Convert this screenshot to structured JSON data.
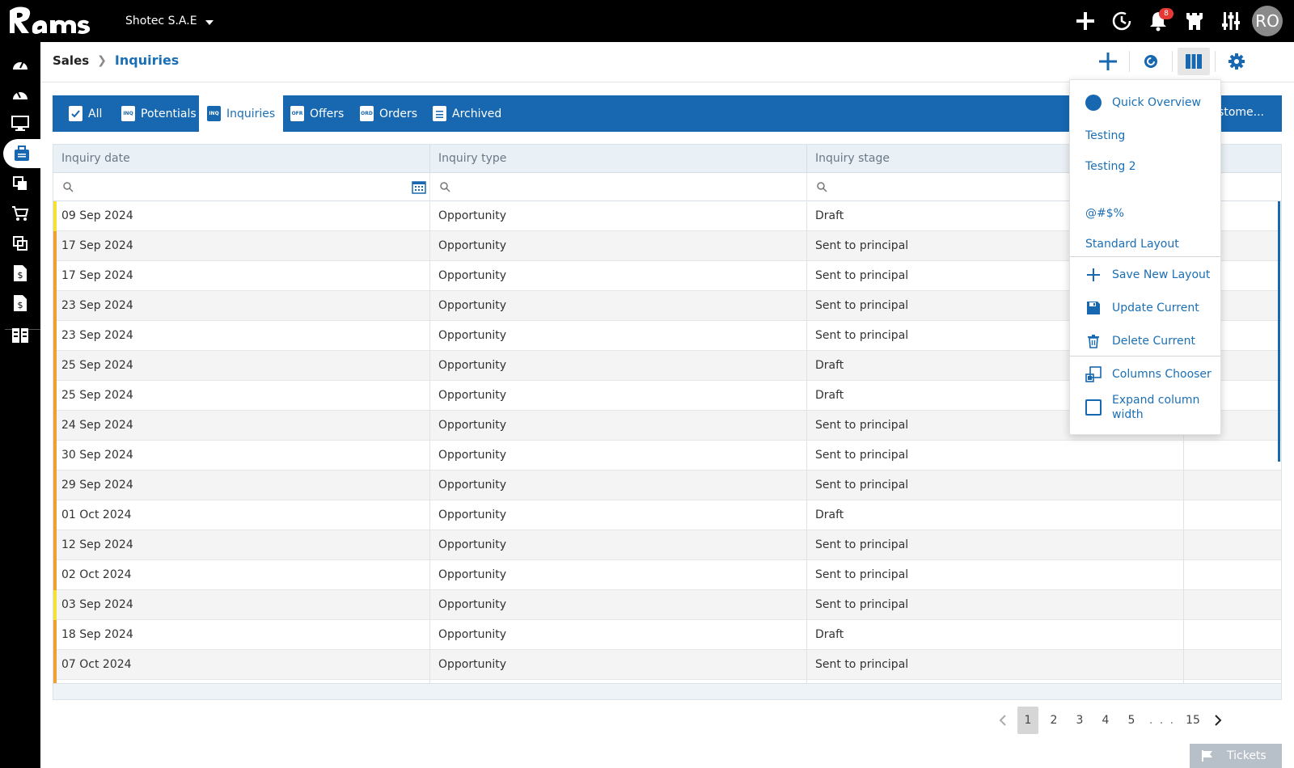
{
  "app": {
    "logo_text": "Rams"
  },
  "topbar": {
    "company": "Shotec S.A.E",
    "notification_count": "8",
    "avatar_initials": "RO"
  },
  "breadcrumb": {
    "root": "Sales",
    "current": "Inquiries"
  },
  "tabs": [
    {
      "label": "All",
      "icon": "checkbox-icon"
    },
    {
      "label": "Potentials",
      "icon": "INQ"
    },
    {
      "label": "Inquiries",
      "icon": "INQ"
    },
    {
      "label": "Offers",
      "icon": "OFR"
    },
    {
      "label": "Orders",
      "icon": "ORD"
    },
    {
      "label": "Archived",
      "icon": "doc-icon"
    }
  ],
  "tabs_right_label": "Custome...",
  "grid": {
    "columns": [
      "Inquiry date",
      "Inquiry type",
      "Inquiry stage",
      ""
    ],
    "rows": [
      {
        "date": "09 Sep 2024",
        "type": "Opportunity",
        "stage": "Draft",
        "flag": "yellow"
      },
      {
        "date": "17 Sep 2024",
        "type": "Opportunity",
        "stage": "Sent to principal",
        "flag": "orange"
      },
      {
        "date": "17 Sep 2024",
        "type": "Opportunity",
        "stage": "Sent to principal",
        "flag": "orange"
      },
      {
        "date": "23 Sep 2024",
        "type": "Opportunity",
        "stage": "Sent to principal",
        "flag": "orange"
      },
      {
        "date": "23 Sep 2024",
        "type": "Opportunity",
        "stage": "Sent to principal",
        "flag": "orange"
      },
      {
        "date": "25 Sep 2024",
        "type": "Opportunity",
        "stage": "Draft",
        "flag": "orange"
      },
      {
        "date": "25 Sep 2024",
        "type": "Opportunity",
        "stage": "Draft",
        "flag": "orange"
      },
      {
        "date": "24 Sep 2024",
        "type": "Opportunity",
        "stage": "Sent to principal",
        "flag": "orange"
      },
      {
        "date": "30 Sep 2024",
        "type": "Opportunity",
        "stage": "Sent to principal",
        "flag": "orange"
      },
      {
        "date": "29 Sep 2024",
        "type": "Opportunity",
        "stage": "Sent to principal",
        "flag": "orange"
      },
      {
        "date": "01 Oct 2024",
        "type": "Opportunity",
        "stage": "Draft",
        "flag": "orange"
      },
      {
        "date": "12 Sep 2024",
        "type": "Opportunity",
        "stage": "Sent to principal",
        "flag": "orange"
      },
      {
        "date": "02 Oct 2024",
        "type": "Opportunity",
        "stage": "Sent to principal",
        "flag": "orange"
      },
      {
        "date": "03 Sep 2024",
        "type": "Opportunity",
        "stage": "Sent to principal",
        "flag": "yellow"
      },
      {
        "date": "18 Sep 2024",
        "type": "Opportunity",
        "stage": "Draft",
        "flag": "orange"
      },
      {
        "date": "07 Oct 2024",
        "type": "Opportunity",
        "stage": "Sent to principal",
        "flag": "orange"
      },
      {
        "date": "",
        "type": "",
        "stage": "",
        "flag": "orange"
      }
    ]
  },
  "pagination": {
    "pages": [
      "1",
      "2",
      "3",
      "4",
      "5"
    ],
    "dots": ". . .",
    "last": "15",
    "current": "1"
  },
  "tickets_label": "Tickets",
  "layout_menu": {
    "quick_overview": "Quick Overview",
    "saved_layouts": [
      "Testing",
      "Testing 2",
      "@#$%",
      "Standard Layout"
    ],
    "save_new": "Save New Layout",
    "update_current": "Update Current",
    "delete_current": "Delete Current",
    "columns_chooser": "Columns Chooser",
    "expand_width": "Expand column width"
  },
  "colors": {
    "brand_blue": "#1768b1",
    "accent_orange": "#f0a030",
    "accent_yellow": "#f3e232",
    "badge_red": "#e53935"
  }
}
